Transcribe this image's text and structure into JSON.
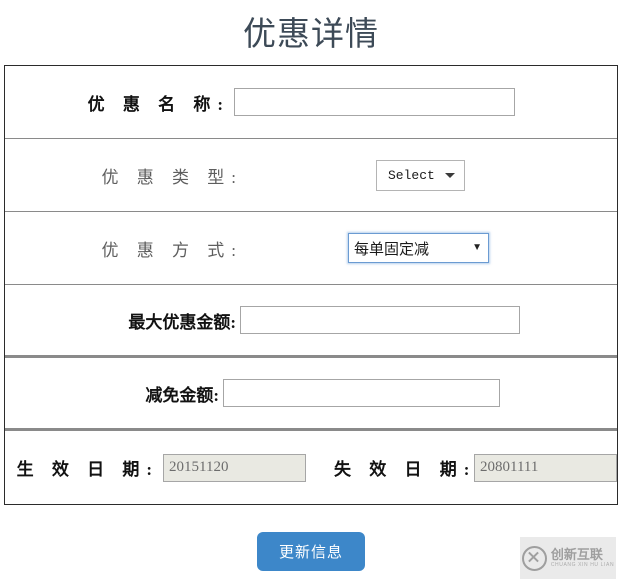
{
  "page": {
    "title": "优惠详情"
  },
  "form": {
    "rows": [
      {
        "key": "promo_name",
        "label": "优 惠 名 称:",
        "control": "text-input",
        "value": "",
        "placeholder": ""
      },
      {
        "key": "promo_type",
        "label": "优 惠 类 型:",
        "control": "select",
        "value": "Select"
      },
      {
        "key": "promo_method",
        "label": "优 惠 方 式:",
        "control": "select-focused",
        "value": "每单固定减"
      },
      {
        "key": "max_discount_amount",
        "label": "最大优惠金额:",
        "control": "text-input",
        "value": "",
        "placeholder": ""
      },
      {
        "key": "reduction_amount",
        "label": "减免金额:",
        "control": "text-input",
        "value": "",
        "placeholder": ""
      }
    ],
    "dates": {
      "start_label": "生 效 日 期:",
      "start_value": "20151120",
      "end_label": "失 效 日 期:",
      "end_value": "20801111"
    }
  },
  "actions": {
    "submit_label": "更新信息"
  },
  "watermark": {
    "brand_cn": "创新互联",
    "brand_en": "CHUANG XIN HU LIAN"
  },
  "colors": {
    "title": "#3d4a57",
    "button": "#3d87c9",
    "focus_border": "#6b9bd2",
    "disabled_field": "#e9e9e2",
    "table_border": "#2b2b2b"
  }
}
